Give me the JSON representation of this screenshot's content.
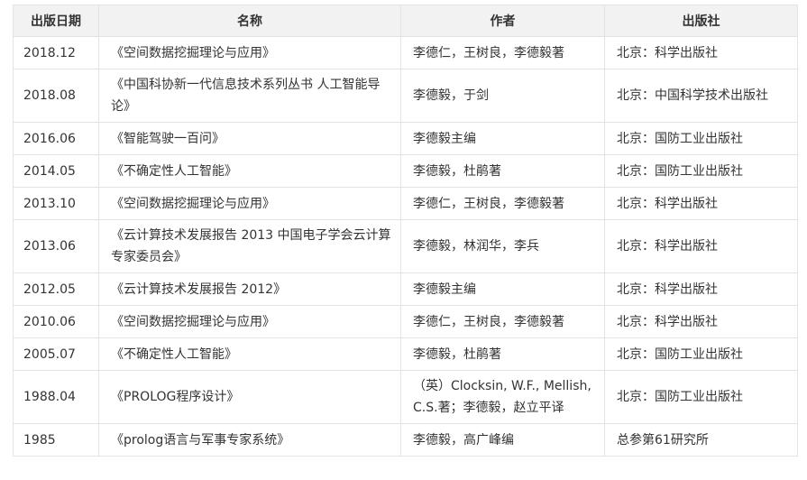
{
  "table": {
    "headers": {
      "date": "出版日期",
      "name": "名称",
      "author": "作者",
      "publisher": "出版社"
    },
    "rows": [
      {
        "date": "2018.12",
        "name": "《空间数据挖掘理论与应用》",
        "author": "李德仁，王树良，李德毅著",
        "publisher": "北京：科学出版社"
      },
      {
        "date": "2018.08",
        "name": "《中国科协新一代信息技术系列丛书 人工智能导论》",
        "author": "李德毅，于剑",
        "publisher": "北京：中国科学技术出版社"
      },
      {
        "date": "2016.06",
        "name": "《智能驾驶一百问》",
        "author": "李德毅主编",
        "publisher": "北京：国防工业出版社"
      },
      {
        "date": "2014.05",
        "name": "《不确定性人工智能》",
        "author": "李德毅，杜鹃著",
        "publisher": "北京：国防工业出版社"
      },
      {
        "date": "2013.10",
        "name": "《空间数据挖掘理论与应用》",
        "author": "李德仁，王树良，李德毅著",
        "publisher": "北京：科学出版社"
      },
      {
        "date": "2013.06",
        "name": "《云计算技术发展报告 2013 中国电子学会云计算专家委员会》",
        "author": "李德毅，林润华，李兵",
        "publisher": "北京：科学出版社"
      },
      {
        "date": "2012.05",
        "name": "《云计算技术发展报告 2012》",
        "author": "李德毅主编",
        "publisher": "北京：科学出版社"
      },
      {
        "date": "2010.06",
        "name": "《空间数据挖掘理论与应用》",
        "author": "李德仁，王树良，李德毅著",
        "publisher": "北京：科学出版社"
      },
      {
        "date": "2005.07",
        "name": "《不确定性人工智能》",
        "author": "李德毅，杜鹃著",
        "publisher": "北京：国防工业出版社"
      },
      {
        "date": "1988.04",
        "name": "《PROLOG程序设计》",
        "author": "（英）Clocksin, W.F., Mellish, C.S.著；李德毅，赵立平译",
        "publisher": "北京：国防工业出版社"
      },
      {
        "date": "1985",
        "name": "《prolog语言与军事专家系统》",
        "author": "李德毅，高广峰编",
        "publisher": "总参第61研究所"
      }
    ]
  }
}
